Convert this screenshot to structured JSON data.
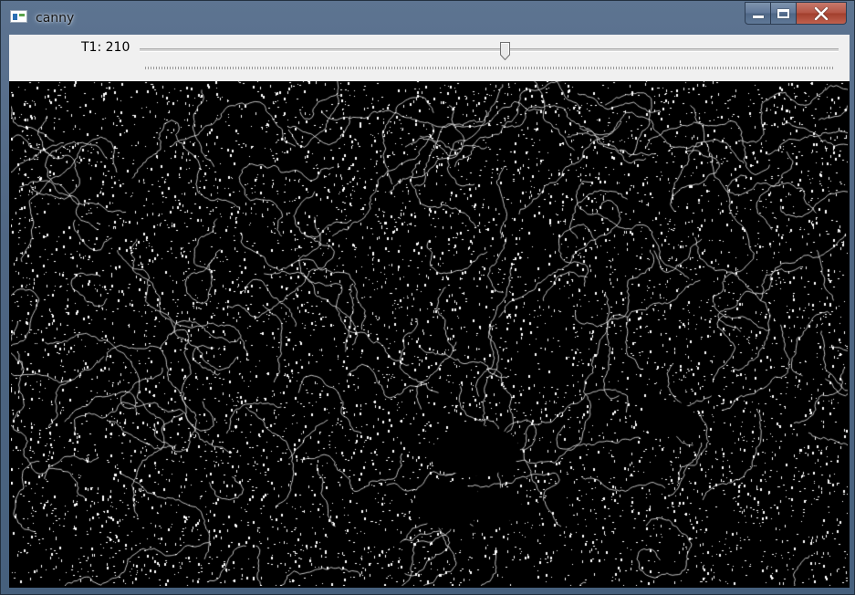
{
  "window": {
    "title": "canny",
    "app_icon": "window-app-icon",
    "controls": [
      "minimize-icon",
      "maximize-icon",
      "close-icon"
    ]
  },
  "trackbar": {
    "label": "T1: 210",
    "value": 210,
    "position_fraction": 0.52
  },
  "image": {
    "description_type": "canny-edge-output",
    "background_color": "#000000",
    "edge_color": "#ffffff"
  }
}
